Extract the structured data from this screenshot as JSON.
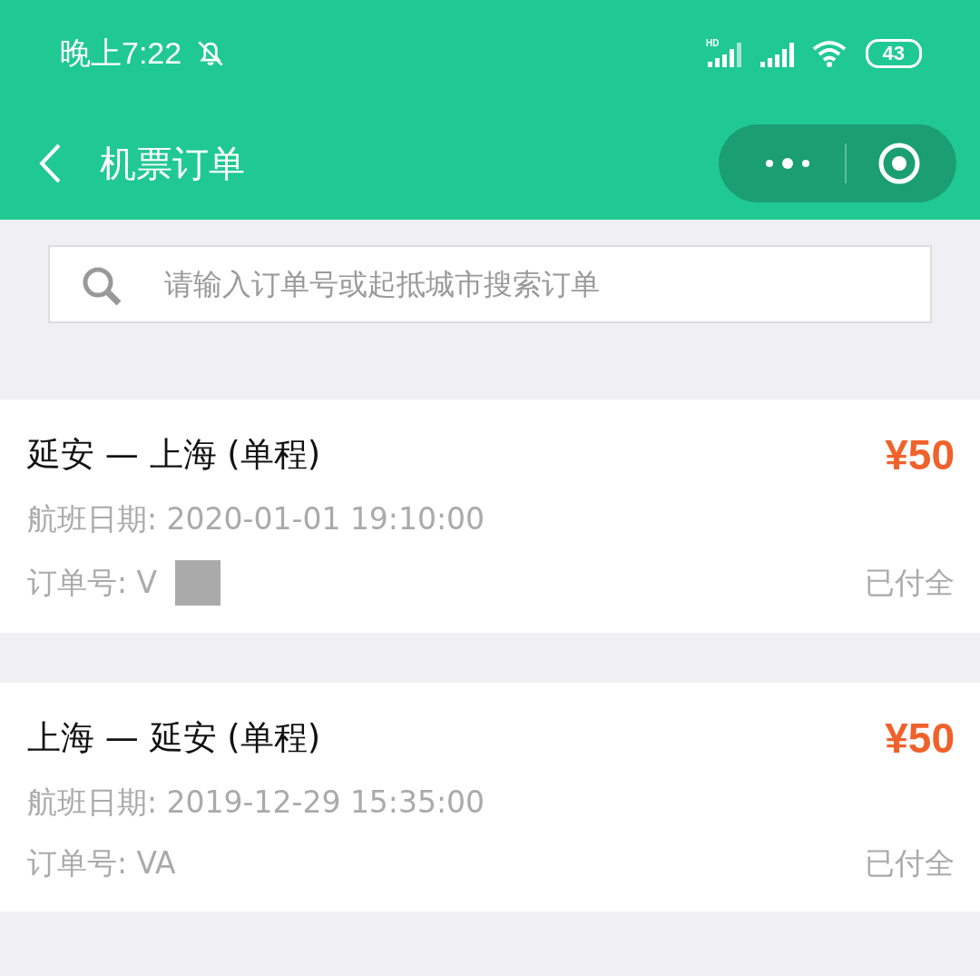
{
  "status_bar": {
    "time": "晚上7:22",
    "network": "HD",
    "battery": "43"
  },
  "nav": {
    "title": "机票订单"
  },
  "search": {
    "placeholder": "请输入订单号或起抵城市搜索订单"
  },
  "orders": [
    {
      "route": "延安 — 上海 (单程)",
      "price": "¥50",
      "date": "航班日期: 2020-01-01 19:10:00",
      "order_no": "订单号: V",
      "redacted": true,
      "status": "已付全"
    },
    {
      "route": "上海 — 延安 (单程)",
      "price": "¥50",
      "date": "航班日期: 2019-12-29 15:35:00",
      "order_no": "订单号: VA",
      "redacted": false,
      "status": "已付全"
    }
  ]
}
